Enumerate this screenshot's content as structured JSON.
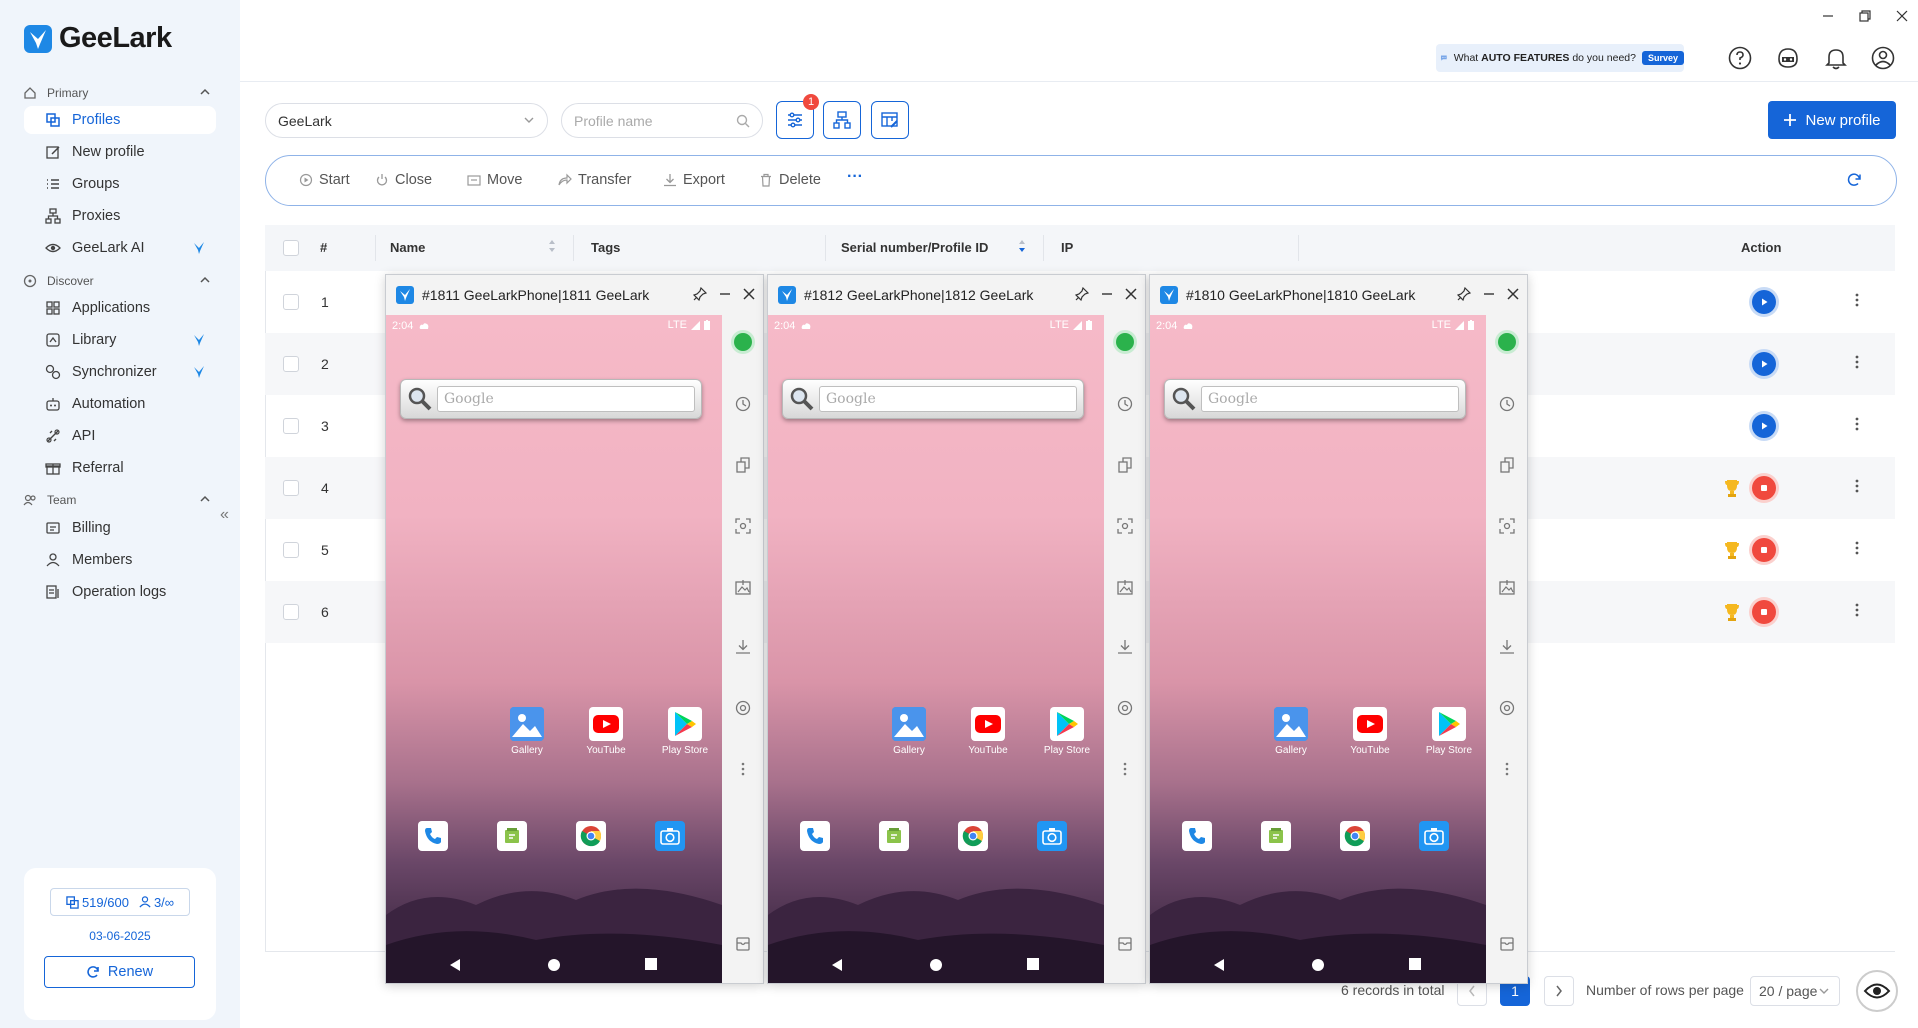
{
  "app": {
    "name": "GeeLark"
  },
  "sidebar": {
    "sections": {
      "primary": "Primary",
      "discover": "Discover",
      "team": "Team"
    },
    "items": [
      {
        "label": "Profiles"
      },
      {
        "label": "New profile"
      },
      {
        "label": "Groups"
      },
      {
        "label": "Proxies"
      },
      {
        "label": "GeeLark AI"
      },
      {
        "label": "Applications"
      },
      {
        "label": "Library"
      },
      {
        "label": "Synchronizer"
      },
      {
        "label": "Automation"
      },
      {
        "label": "API"
      },
      {
        "label": "Referral"
      },
      {
        "label": "Billing"
      },
      {
        "label": "Members"
      },
      {
        "label": "Operation logs"
      }
    ],
    "collapse": "«",
    "card": {
      "profiles": "519/600",
      "members": "3/∞",
      "date": "03-06-2025",
      "renew": "Renew"
    }
  },
  "topbar": {
    "survey_prefix": "What ",
    "survey_bold": "AUTO FEATURES",
    "survey_suffix": " do you need?",
    "survey_tag": "Survey"
  },
  "toolbar": {
    "group_select": "GeeLark",
    "search_placeholder": "Profile name",
    "filter_badge": "1",
    "new_profile": "New profile"
  },
  "actions": {
    "start": "Start",
    "close": "Close",
    "move": "Move",
    "transfer": "Transfer",
    "export": "Export",
    "delete": "Delete",
    "more": "···"
  },
  "table": {
    "headers": {
      "num": "#",
      "name": "Name",
      "tags": "Tags",
      "serial": "Serial number/Profile ID",
      "ip": "IP",
      "action": "Action"
    },
    "rows": [
      {
        "n": "1",
        "state": "stopped"
      },
      {
        "n": "2",
        "state": "stopped"
      },
      {
        "n": "3",
        "state": "stopped"
      },
      {
        "n": "4",
        "state": "running"
      },
      {
        "n": "5",
        "state": "running"
      },
      {
        "n": "6",
        "state": "running"
      }
    ]
  },
  "pagination": {
    "total": "6 records in total",
    "current": "1",
    "rows_label": "Number of rows per page",
    "per_page": "20 / page"
  },
  "phones": [
    {
      "title": "#1811 GeeLarkPhone|1811 GeeLark"
    },
    {
      "title": "#1812 GeeLarkPhone|1812 GeeLark"
    },
    {
      "title": "#1810 GeeLarkPhone|1810 GeeLark"
    }
  ],
  "phone_screen": {
    "time": "2:04",
    "network": "LTE",
    "search_hint": "Google",
    "apps": [
      "Gallery",
      "YouTube",
      "Play Store"
    ]
  },
  "colors": {
    "accent": "#1565d8",
    "danger": "#f0493e",
    "online": "#2bb24c",
    "sidebar_bg": "#f0f5fb"
  }
}
